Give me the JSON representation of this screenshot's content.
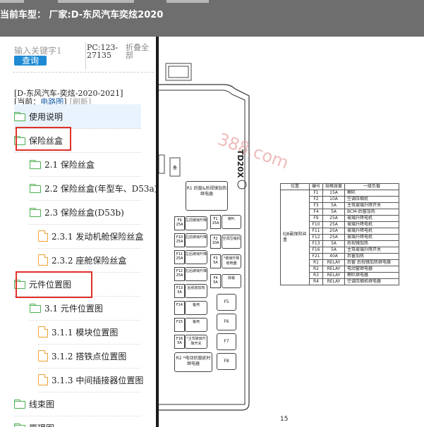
{
  "header": {
    "title": "当前车型：  厂家:D-东风汽车奕炫2020"
  },
  "sidebar": {
    "search_placeholder": "输入关键字1",
    "search_button": "查询",
    "pc_code": "PC:123-27135",
    "collapse_all": "折叠全部",
    "car_model": "[D-东风汽车-奕炫-2020-2021]",
    "current_label": "[当前：",
    "current_path": "电路图",
    "current_close": "]",
    "refresh": "[刷新]",
    "tree": [
      {
        "label": "使用说明",
        "icon": "folder-icon",
        "level": 0,
        "active": true
      },
      {
        "label": "保险丝盒",
        "icon": "folder-icon",
        "level": 0,
        "highlighted": true
      },
      {
        "label": "2.1 保险丝盒",
        "icon": "folder-icon",
        "level": 1
      },
      {
        "label": "2.2 保险丝盒(年型车、D53a)",
        "icon": "folder-icon",
        "level": 1
      },
      {
        "label": "2.3 保险丝盒(D53b)",
        "icon": "folder-icon",
        "level": 1
      },
      {
        "label": "2.3.1 发动机舱保险丝盒",
        "icon": "file-icon",
        "level": 2
      },
      {
        "label": "2.3.2 座舱保险丝盒",
        "icon": "file-icon",
        "level": 2
      },
      {
        "label": "元件位置图",
        "icon": "folder-icon",
        "level": 0,
        "highlighted": true
      },
      {
        "label": "3.1 元件位置图",
        "icon": "folder-icon",
        "level": 1
      },
      {
        "label": "3.1.1 模块位置图",
        "icon": "file-icon",
        "level": 2
      },
      {
        "label": "3.1.2 搭铁点位置图",
        "icon": "file-icon",
        "level": 2
      },
      {
        "label": "3.1.3 中间插接器位置图",
        "icon": "file-icon",
        "level": 2
      },
      {
        "label": "线束图",
        "icon": "folder-icon",
        "level": 0
      },
      {
        "label": "原理图",
        "icon": "folder-icon",
        "level": 0
      }
    ]
  },
  "document": {
    "watermark": "388.com",
    "box_code": "TD20X",
    "relay_r1": "R1 后窗&后视镜加热继电器",
    "relay_r2": "R2 *电动后窗延时继电器",
    "fuse_labels": [
      {
        "id": "F9",
        "amp": "25A",
        "desc": "左前玻璃升降"
      },
      {
        "id": "F10",
        "amp": "25A",
        "desc": "右前玻璃升降"
      },
      {
        "id": "F11",
        "amp": "25A",
        "desc": "左后玻璃升降"
      },
      {
        "id": "F12",
        "amp": "25A",
        "desc": "右后玻璃升降"
      },
      {
        "id": "F13",
        "amp": "5A",
        "desc": "后视镜加热"
      },
      {
        "id": "F14",
        "amp": "",
        "desc": "备用"
      },
      {
        "id": "F15",
        "amp": "",
        "desc": "备用"
      },
      {
        "id": "F16",
        "amp": "5A",
        "desc": "*主驾玻璃升降开关"
      }
    ],
    "right_fuses": [
      {
        "id": "F1",
        "amp": "15A",
        "desc": "喇叭"
      },
      {
        "id": "F2",
        "amp": "10A",
        "desc": "空调压缩机"
      },
      {
        "id": "F3",
        "amp": "5A",
        "desc": "*玻璃升降继电器"
      },
      {
        "id": "F4",
        "amp": "5A",
        "desc": "除霜"
      },
      {
        "id": "F5",
        "amp": "",
        "desc": ""
      },
      {
        "id": "F6",
        "amp": "",
        "desc": ""
      },
      {
        "id": "F7",
        "amp": "",
        "desc": ""
      },
      {
        "id": "F8",
        "amp": "",
        "desc": ""
      }
    ],
    "table_headers": [
      "位置",
      "编号",
      "规格容量",
      "一级负载"
    ],
    "table_location": "EJB副保险丝盒",
    "table_rows": [
      [
        "F1",
        "15A",
        "喇叭"
      ],
      [
        "F2",
        "10A",
        "空调压缩机"
      ],
      [
        "F3",
        "5A",
        "主驾玻璃升降开关"
      ],
      [
        "F4",
        "5A",
        "BCM-后窗加热"
      ],
      [
        "F9",
        "25A",
        "玻璃升降电机"
      ],
      [
        "F10",
        "25A",
        "玻璃升降电机"
      ],
      [
        "F11",
        "25A",
        "玻璃升降电机"
      ],
      [
        "F12",
        "25A",
        "玻璃升降电机"
      ],
      [
        "F13",
        "5A",
        "后视镜加热"
      ],
      [
        "F16",
        "5A",
        "主驾玻璃升降开关"
      ],
      [
        "F21",
        "40A",
        "后窗加热"
      ],
      [
        "R1",
        "RELAY",
        "后窗 后视镜加热继电器"
      ],
      [
        "R2",
        "RELAY",
        "电动窗继电器"
      ],
      [
        "R3",
        "RELAY",
        "喇叭继电器"
      ],
      [
        "R4",
        "RELAY",
        "空调压缩机继电器"
      ]
    ],
    "page_number": "15"
  }
}
